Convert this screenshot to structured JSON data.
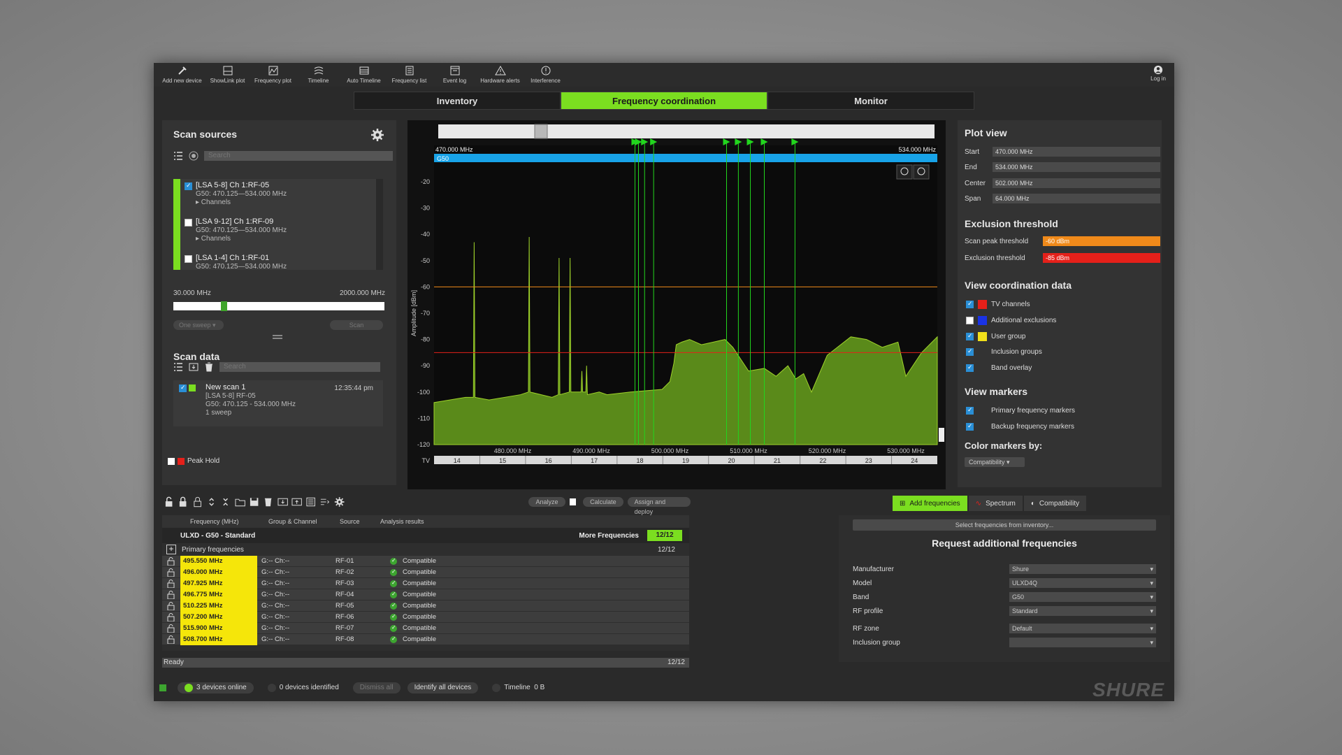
{
  "toolbar": {
    "items": [
      {
        "label": "Add new device",
        "icon": "add-device-icon"
      },
      {
        "label": "ShowLink plot",
        "icon": "showlink-icon"
      },
      {
        "label": "Frequency plot",
        "icon": "frequency-plot-icon"
      },
      {
        "label": "Timeline",
        "icon": "timeline-icon"
      },
      {
        "label": "Auto Timeline",
        "icon": "auto-timeline-icon"
      },
      {
        "label": "Frequency list",
        "icon": "frequency-list-icon"
      },
      {
        "label": "Event log",
        "icon": "event-log-icon"
      },
      {
        "label": "Hardware alerts",
        "icon": "warning-icon"
      },
      {
        "label": "Interference",
        "icon": "interference-icon"
      }
    ],
    "login_label": "Log in"
  },
  "tabs": [
    "Inventory",
    "Frequency coordination",
    "Monitor"
  ],
  "active_tab": "Frequency coordination",
  "scan_sources": {
    "title": "Scan sources",
    "search_placeholder": "Search",
    "items": [
      {
        "name": "[LSA 5-8]  Ch 1:RF-05",
        "range": "G50: 470.125—534.000 MHz",
        "sub": "▸ Channels",
        "checked": true
      },
      {
        "name": "[LSA 9-12]  Ch 1:RF-09",
        "range": "G50: 470.125—534.000 MHz",
        "sub": "▸ Channels",
        "checked": false
      },
      {
        "name": "[LSA 1-4]  Ch 1:RF-01",
        "range": "G50: 470.125—534.000 MHz",
        "sub": "",
        "checked": false
      }
    ],
    "range_min": "30.000 MHz",
    "range_max": "2000.000 MHz",
    "sweep_mode": "One sweep",
    "scan_button": "Scan"
  },
  "scan_data": {
    "title": "Scan data",
    "search_placeholder": "Search",
    "item": {
      "name": "New scan 1",
      "time": "12:35:44 pm",
      "line2": "[LSA 5-8] RF-05",
      "line3": "G50: 470.125 - 534.000 MHz",
      "line4": "1 sweep"
    },
    "peak_hold": "Peak Hold"
  },
  "chart": {
    "start_label": "470.000 MHz",
    "end_label": "534.000 MHz",
    "band_label": "G50",
    "ylabel": "Amplitude [dBm]",
    "tv_label": "TV"
  },
  "chart_data": {
    "type": "area",
    "xlim": [
      470,
      534
    ],
    "ylim": [
      -120,
      -20
    ],
    "yticks": [
      -20,
      -30,
      -40,
      -50,
      -60,
      -70,
      -80,
      -90,
      -100,
      -110,
      -120
    ],
    "xticks": [
      480,
      490,
      500,
      510,
      520,
      530
    ],
    "xtick_labels": [
      "480.000 MHz",
      "490.000 MHz",
      "500.000 MHz",
      "510.000 MHz",
      "520.000 MHz",
      "530.000 MHz"
    ],
    "tv_channels": [
      "14",
      "15",
      "16",
      "17",
      "18",
      "19",
      "20",
      "21",
      "22",
      "23",
      "24"
    ],
    "thresholds": {
      "scan_peak": -60,
      "exclusion": -85
    },
    "spectrum_x": [
      470.0,
      474.0,
      475.0,
      475.1,
      475.2,
      477.0,
      481.0,
      482.0,
      482.1,
      482.2,
      485.0,
      485.8,
      485.9,
      486.0,
      487.2,
      487.3,
      487.4,
      488.7,
      488.8,
      488.9,
      489.3,
      489.4,
      489.5,
      491.0,
      492.0,
      495.0,
      499.0,
      500.0,
      500.5,
      500.8,
      501.5,
      502.5,
      504.0,
      507.0,
      508.0,
      510.0,
      512.0,
      513.5,
      515.0,
      516.0,
      517.0,
      518.0,
      520.0,
      523.0,
      525.0,
      527.0,
      529.0,
      530.0,
      532.0,
      533.0,
      534.0
    ],
    "spectrum_y": [
      -104,
      -102,
      -102,
      -43,
      -102,
      -103,
      -101,
      -100,
      -41,
      -100,
      -102,
      -101,
      -49,
      -101,
      -100,
      -49,
      -100,
      -100,
      -92,
      -100,
      -100,
      -90,
      -101,
      -100,
      -101,
      -100,
      -99,
      -96,
      -89,
      -82,
      -81,
      -80,
      -82,
      -80,
      -83,
      -92,
      -91,
      -94,
      -90,
      -95,
      -93,
      -100,
      -86,
      -79,
      -80,
      -83,
      -81,
      -94,
      -85,
      -82,
      -79
    ],
    "markers_mhz": [
      495.55,
      496.0,
      496.775,
      497.925,
      507.2,
      508.7,
      510.225,
      512.0,
      515.9
    ]
  },
  "plot_view": {
    "title": "Plot view",
    "fields": [
      {
        "k": "Start",
        "v": "470.000 MHz"
      },
      {
        "k": "End",
        "v": "534.000 MHz"
      },
      {
        "k": "Center",
        "v": "502.000 MHz"
      },
      {
        "k": "Span",
        "v": "64.000 MHz"
      }
    ]
  },
  "exclusion": {
    "title": "Exclusion threshold",
    "scan_peak_label": "Scan peak threshold",
    "scan_peak_value": "-60 dBm",
    "exclusion_label": "Exclusion threshold",
    "exclusion_value": "-85 dBm"
  },
  "view_coord": {
    "title": "View coordination data",
    "items": [
      {
        "label": "TV channels",
        "checked": true,
        "color": "#e5201a"
      },
      {
        "label": "Additional exclusions",
        "checked": false,
        "color": "#1a33e5"
      },
      {
        "label": "User group",
        "checked": true,
        "color": "#f2e01a"
      },
      {
        "label": "Inclusion groups",
        "checked": true,
        "color": ""
      },
      {
        "label": "Band overlay",
        "checked": true,
        "color": ""
      }
    ]
  },
  "view_markers": {
    "title": "View markers",
    "items": [
      {
        "label": "Primary frequency markers",
        "checked": true
      },
      {
        "label": "Backup frequency markers",
        "checked": true
      }
    ],
    "color_by_title": "Color markers by:",
    "color_by_value": "Compatibility"
  },
  "table": {
    "buttons": [
      "Analyze",
      "Calculate",
      "Assign and deploy"
    ],
    "headers": [
      "Frequency (MHz)",
      "Group & Channel",
      "Source",
      "Analysis results"
    ],
    "group_name": "ULXD - G50 - Standard",
    "more_frequencies": "More Frequencies",
    "group_count": "12/12",
    "primary_label": "Primary frequencies",
    "primary_count": "12/12",
    "rows": [
      {
        "freq": "495.550 MHz",
        "grp": "G:-- Ch:--",
        "src": "RF-01",
        "result": "Compatible"
      },
      {
        "freq": "496.000 MHz",
        "grp": "G:-- Ch:--",
        "src": "RF-02",
        "result": "Compatible"
      },
      {
        "freq": "497.925 MHz",
        "grp": "G:-- Ch:--",
        "src": "RF-03",
        "result": "Compatible"
      },
      {
        "freq": "496.775 MHz",
        "grp": "G:-- Ch:--",
        "src": "RF-04",
        "result": "Compatible"
      },
      {
        "freq": "510.225 MHz",
        "grp": "G:-- Ch:--",
        "src": "RF-05",
        "result": "Compatible"
      },
      {
        "freq": "507.200 MHz",
        "grp": "G:-- Ch:--",
        "src": "RF-06",
        "result": "Compatible"
      },
      {
        "freq": "515.900 MHz",
        "grp": "G:-- Ch:--",
        "src": "RF-07",
        "result": "Compatible"
      },
      {
        "freq": "508.700 MHz",
        "grp": "G:-- Ch:--",
        "src": "RF-08",
        "result": "Compatible"
      }
    ],
    "status": "Ready",
    "status_count": "12/12"
  },
  "request": {
    "tabs": [
      "Add frequencies",
      "Spectrum",
      "Compatibility"
    ],
    "select_button": "Select frequencies from inventory...",
    "title": "Request additional frequencies",
    "fields": [
      {
        "k": "Manufacturer",
        "v": "Shure"
      },
      {
        "k": "Model",
        "v": "ULXD4Q"
      },
      {
        "k": "Band",
        "v": "G50"
      },
      {
        "k": "RF profile",
        "v": "Standard"
      },
      {
        "k": "RF zone",
        "v": "Default"
      },
      {
        "k": "Inclusion group",
        "v": ""
      }
    ]
  },
  "footer": {
    "devices_online": "3 devices online",
    "devices_identified": "0 devices identified",
    "dismiss": "Dismiss all",
    "identify": "Identify all devices",
    "timeline": "Timeline",
    "timeline_size": "0 B",
    "brand": "SHURE"
  },
  "colors": {
    "accent": "#7bde20",
    "scan_peak": "#f08a1a",
    "exclusion": "#e5201a",
    "band": "#18a3e8",
    "spectrum": "#5a8a1a",
    "marker": "#22d61e"
  }
}
